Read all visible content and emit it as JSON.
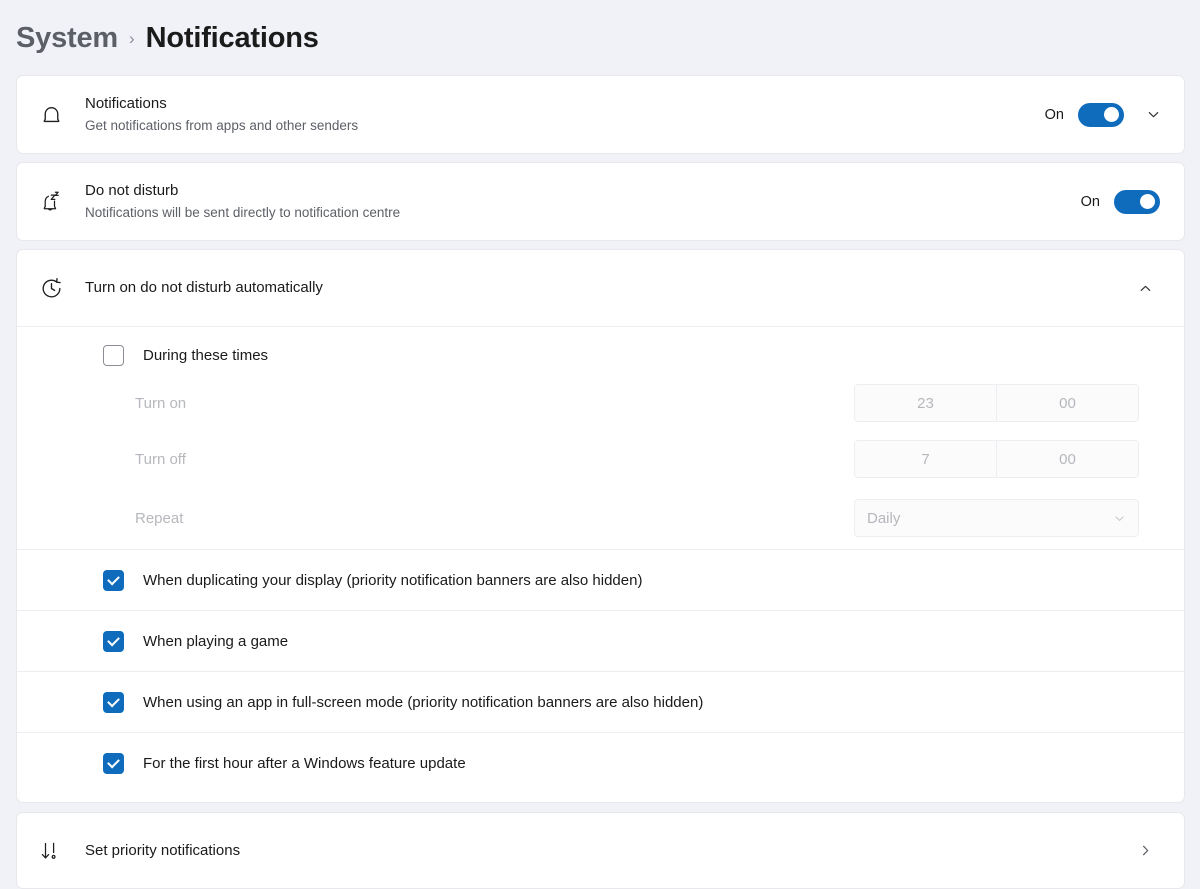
{
  "breadcrumb": {
    "parent": "System",
    "separator": "›",
    "current": "Notifications"
  },
  "colors": {
    "accent": "#0f6cbd",
    "page_background": "#f1f2f7",
    "card_background": "#ffffff",
    "text_primary": "#1a1a1a",
    "text_secondary": "#5d6067",
    "text_disabled": "#b5b7bc"
  },
  "cards": {
    "notifications": {
      "icon": "bell-icon",
      "title": "Notifications",
      "subtitle": "Get notifications from apps and other senders",
      "toggle_label": "On",
      "toggle_state": "on",
      "expander_icon": "chevron-down-icon"
    },
    "do_not_disturb": {
      "icon": "bell-sleep-icon",
      "title": "Do not disturb",
      "subtitle": "Notifications will be sent directly to notification centre",
      "toggle_label": "On",
      "toggle_state": "on"
    },
    "auto_dnd": {
      "icon": "clock-icon",
      "title": "Turn on do not disturb automatically",
      "expander_icon": "chevron-up-icon",
      "expanded": true,
      "during_times": {
        "label": "During these times",
        "checked": false
      },
      "schedule": [
        {
          "label": "Turn on",
          "hour": "23",
          "minute": "00"
        },
        {
          "label": "Turn off",
          "hour": "7",
          "minute": "00"
        }
      ],
      "repeat": {
        "label": "Repeat",
        "value": "Daily",
        "dropdown_icon": "chevron-down-icon"
      },
      "conditions": [
        {
          "label": "When duplicating your display (priority notification banners are also hidden)",
          "checked": true
        },
        {
          "label": "When playing a game",
          "checked": true
        },
        {
          "label": "When using an app in full-screen mode (priority notification banners are also hidden)",
          "checked": true
        },
        {
          "label": "For the first hour after a Windows feature update",
          "checked": true
        }
      ]
    },
    "priority_notifications": {
      "icon": "priority-arrow-icon",
      "title": "Set priority notifications",
      "navigate_icon": "chevron-right-icon"
    }
  }
}
